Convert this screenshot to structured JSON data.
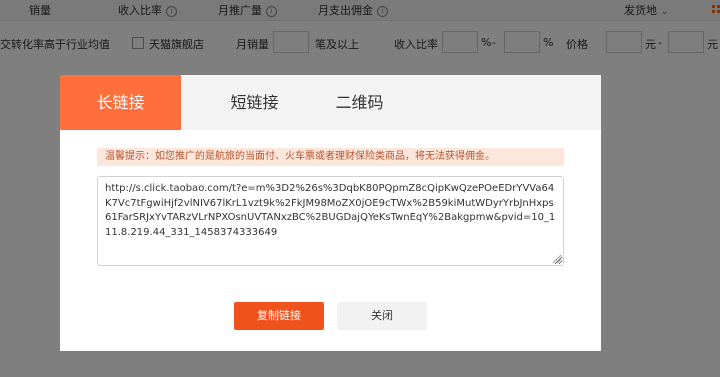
{
  "header": {
    "col_sales": "销量",
    "col_income_ratio": "收入比率",
    "col_monthly_promo": "月推广量",
    "col_monthly_commission": "月支出佣金",
    "col_ship_from": "发货地"
  },
  "filters": {
    "conversion_label": "交转化率高于行业均值",
    "tmall_label": "天猫旗舰店",
    "monthly_sales_label": "月销量",
    "monthly_sales_suffix": "笔及以上",
    "income_ratio_label": "收入比率",
    "percent": "%",
    "dash": "-",
    "price_label": "价格",
    "yuan": "元"
  },
  "dialog": {
    "tabs": [
      "长链接",
      "短链接",
      "二维码"
    ],
    "active_tab": 0,
    "notice": "温馨提示：如您推广的是航旅的当面付、火车票或者理财保险类商品，将无法获得佣金。",
    "link_value": "http://s.click.taobao.com/t?e=m%3D2%26s%3DqbK80PQpmZ8cQipKwQzePOeEDrYVVa64K7Vc7tFgwiHjf2vlNIV67lKrL1vzt9k%2FkJM98MoZX0jOE9cTWx%2B59kiMutWDyrYrbJnHxps61FarSRJxYvTARzVLrNPXOsnUVTANxzBC%2BUGDajQYeKsTwnEqY%2Bakgpmw&pvid=10_111.8.219.44_331_1458374333649",
    "copy_button": "复制链接",
    "close_button": "关闭"
  },
  "colors": {
    "accent": "#ff6f3d",
    "primary_button": "#f0521c",
    "notice_bg": "#fde6dc"
  }
}
